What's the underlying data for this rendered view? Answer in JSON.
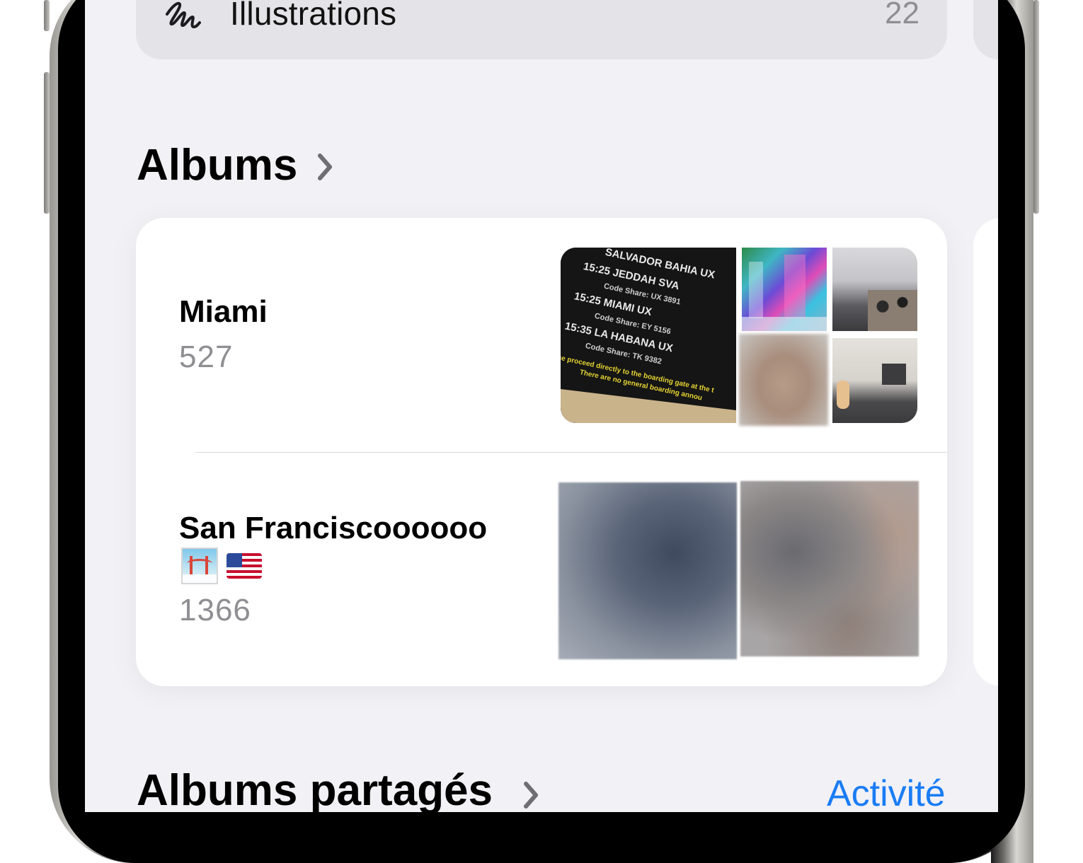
{
  "top_item": {
    "label": "Illustrations",
    "count": "22",
    "icon": "scribble-icon"
  },
  "albums_section": {
    "title": "Albums",
    "chevron": "chevron-right-icon"
  },
  "albums": [
    {
      "name": "Miami",
      "count": "527"
    },
    {
      "name": "San Franciscoooooo",
      "emoji": "🌁 🇺🇸",
      "count": "1366"
    }
  ],
  "thumbnails": {
    "miami_board_lines": [
      "SALVADOR BAHIA UX",
      "15:25 JEDDAH  SVA",
      "Code Share: UX 3891",
      "15:25 MIAMI  UX",
      "Code Share: EY 5156",
      "15:35 LA HABANA  UX",
      "Code Share: TK 9382",
      "ease proceed directly to the boarding gate at the t",
      "There are no general boarding annou"
    ]
  },
  "shared_section": {
    "title": "Albums partagés",
    "action": "Activité"
  },
  "colors": {
    "accent": "#1a7cf5",
    "background": "#f1f1f6",
    "card": "#ffffff",
    "secondary_text": "#8e8e93"
  }
}
